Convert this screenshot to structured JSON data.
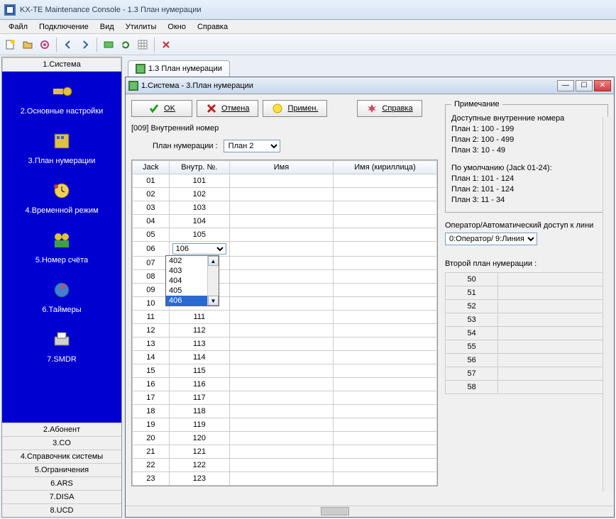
{
  "window": {
    "title": "KX-TE Maintenance Console - 1.3 План нумерации"
  },
  "menu": [
    "Файл",
    "Подключение",
    "Вид",
    "Утилиты",
    "Окно",
    "Справка"
  ],
  "sidebar": {
    "header": "1.Система",
    "items": [
      {
        "label": "2.Основные настройки",
        "icon": "key-icon"
      },
      {
        "label": "3.План нумерации",
        "icon": "numplan-icon"
      },
      {
        "label": "4.Временной режим",
        "icon": "clock-icon"
      },
      {
        "label": "5.Номер счёта",
        "icon": "account-icon"
      },
      {
        "label": "6.Таймеры",
        "icon": "timer-icon"
      },
      {
        "label": "7.SMDR",
        "icon": "printer-icon"
      }
    ],
    "bottom": [
      "2.Абонент",
      "3.CO",
      "4.Справочник системы",
      "5.Ограничения",
      "6.ARS",
      "7.DISA",
      "8.UCD"
    ]
  },
  "tab": {
    "label": "1.3 План нумерации"
  },
  "subwindow": {
    "title": "1.Система - 3.План нумерации"
  },
  "actions": {
    "ok": "OK",
    "cancel": "Отмена",
    "apply": "Примен.",
    "help": "Справка"
  },
  "field_title": "[009] Внутренний номер",
  "plan_label": "План нумерации :",
  "plan_selected": "План 2",
  "table": {
    "headers": [
      "Jack",
      "Внутр. №.",
      "Имя",
      "Имя (кириллица)"
    ],
    "rows": [
      {
        "jack": "01",
        "num": "101"
      },
      {
        "jack": "02",
        "num": "102"
      },
      {
        "jack": "03",
        "num": "103"
      },
      {
        "jack": "04",
        "num": "104"
      },
      {
        "jack": "05",
        "num": "105"
      },
      {
        "jack": "06",
        "num": "106",
        "combo": true
      },
      {
        "jack": "07",
        "num": ""
      },
      {
        "jack": "08",
        "num": ""
      },
      {
        "jack": "09",
        "num": ""
      },
      {
        "jack": "10",
        "num": ""
      },
      {
        "jack": "11",
        "num": "111"
      },
      {
        "jack": "12",
        "num": "112"
      },
      {
        "jack": "13",
        "num": "113"
      },
      {
        "jack": "14",
        "num": "114"
      },
      {
        "jack": "15",
        "num": "115"
      },
      {
        "jack": "16",
        "num": "116"
      },
      {
        "jack": "17",
        "num": "117"
      },
      {
        "jack": "18",
        "num": "118"
      },
      {
        "jack": "19",
        "num": "119"
      },
      {
        "jack": "20",
        "num": "120"
      },
      {
        "jack": "21",
        "num": "121"
      },
      {
        "jack": "22",
        "num": "122"
      },
      {
        "jack": "23",
        "num": "123"
      }
    ],
    "dropdown_options": [
      "402",
      "403",
      "404",
      "405",
      "406"
    ],
    "dropdown_selected": "406"
  },
  "notes": {
    "legend": "Примечание",
    "lines_a": [
      "Доступные внутренние номера",
      "План 1: 100 - 199",
      "План 2: 100 - 499",
      "План 3:  10 -  49"
    ],
    "lines_b": [
      "По умолчанию (Jack 01-24):",
      "План 1: 101 - 124",
      "План 2: 101 - 124",
      "План 3:  11 -  34"
    ]
  },
  "operator": {
    "label": "Оператор/Автоматический доступ к лини",
    "selected": "0:Оператор/ 9:Линия"
  },
  "second_plan": {
    "label": "Второй план нумерации :",
    "rows": [
      "50",
      "51",
      "52",
      "53",
      "54",
      "55",
      "56",
      "57",
      "58"
    ]
  }
}
